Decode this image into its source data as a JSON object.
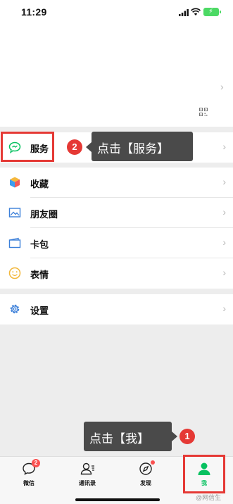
{
  "status_bar": {
    "time": "11:29"
  },
  "menu": {
    "services": "服务",
    "favorites": "收藏",
    "moments": "朋友圈",
    "cards": "卡包",
    "stickers": "表情",
    "settings": "设置"
  },
  "annotations": {
    "step2_label": "点击【服务】",
    "step2_number": "2",
    "step1_label": "点击【我】",
    "step1_number": "1"
  },
  "tabbar": {
    "chats": "微信",
    "chats_badge": "2",
    "contacts": "通讯录",
    "discover": "发现",
    "me": "我"
  },
  "colors": {
    "accent_green": "#07c160",
    "annotation_red": "#e53935",
    "callout_bg": "#4a4a4a"
  },
  "watermark": "@网信生"
}
